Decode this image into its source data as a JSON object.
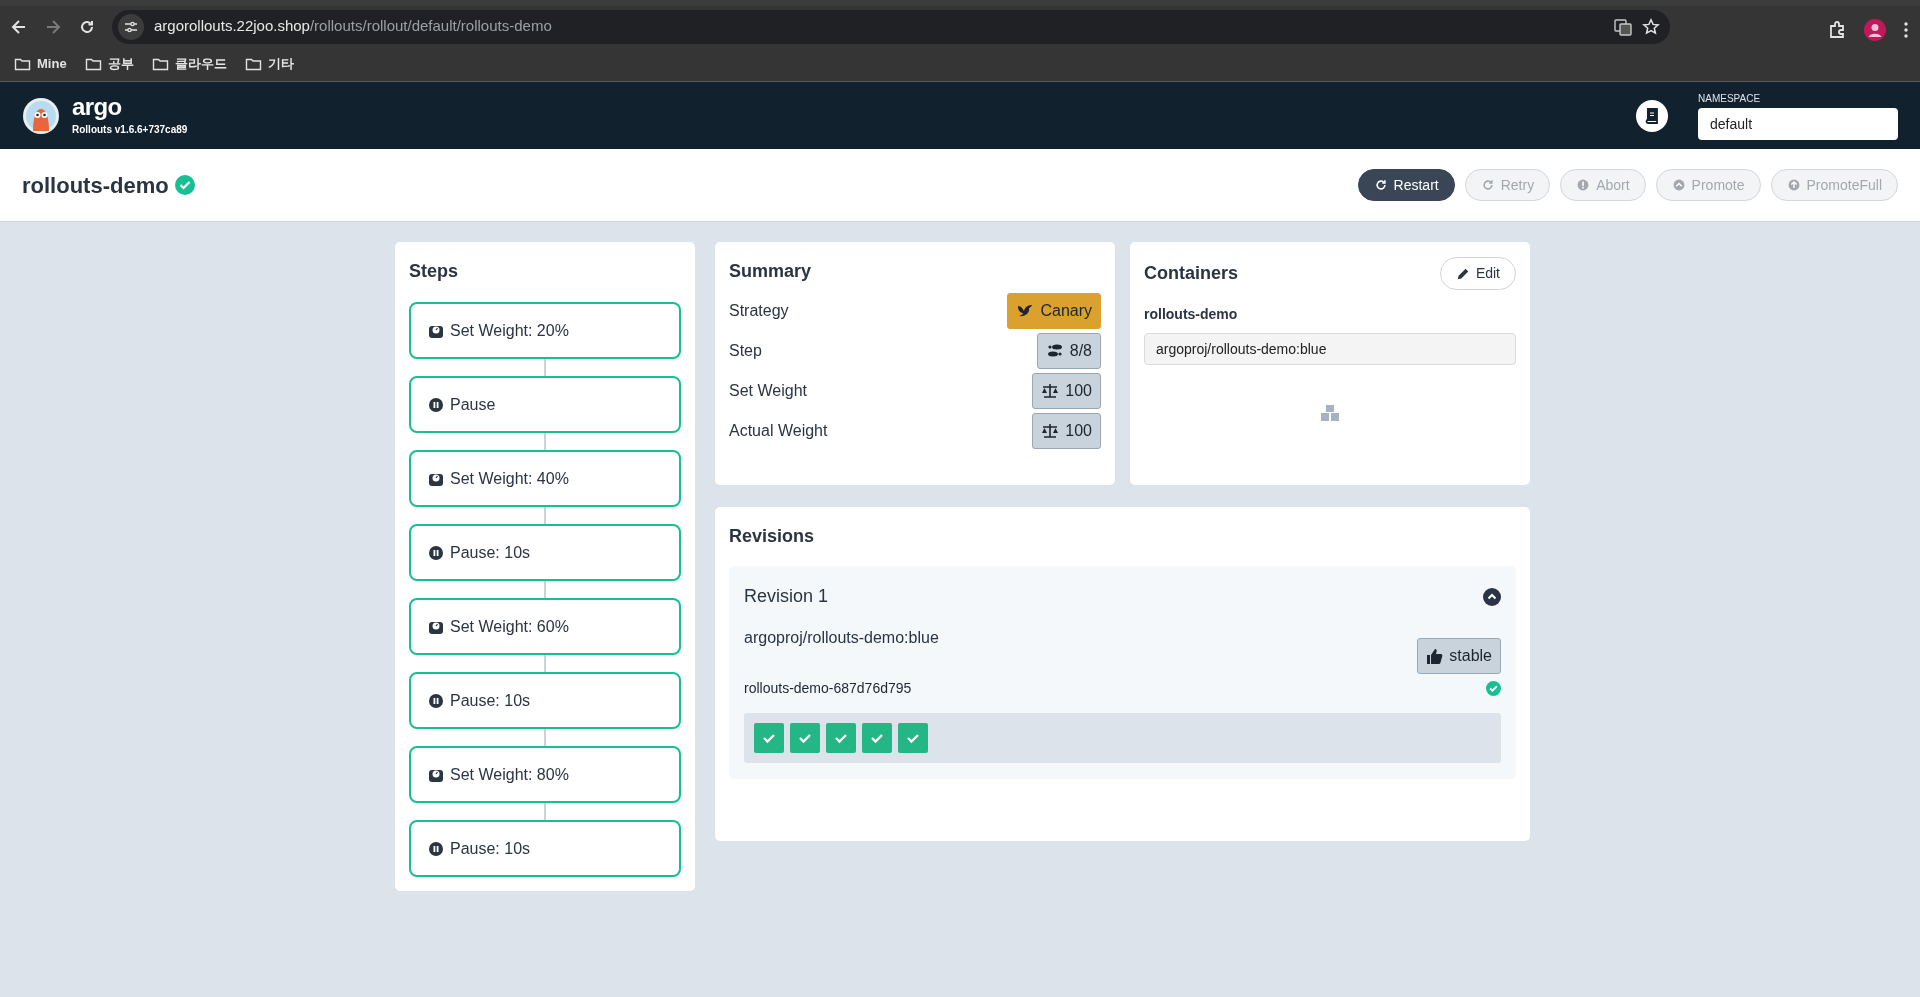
{
  "browser": {
    "url_host": "argorollouts.22joo.shop",
    "url_path": "/rollouts/rollout/default/rollouts-demo",
    "bookmarks": [
      "Mine",
      "공부",
      "클라우드",
      "기타"
    ]
  },
  "header": {
    "logo": "argo",
    "version": "Rollouts v1.6.6+737ca89",
    "namespace_label": "NAMESPACE",
    "namespace": "default"
  },
  "rollout": {
    "name": "rollouts-demo",
    "healthy": true,
    "actions": [
      {
        "label": "Restart",
        "kind": "restart",
        "disabled": false
      },
      {
        "label": "Retry",
        "kind": "retry",
        "disabled": true
      },
      {
        "label": "Abort",
        "kind": "abort",
        "disabled": true
      },
      {
        "label": "Promote",
        "kind": "promote",
        "disabled": true
      },
      {
        "label": "PromoteFull",
        "kind": "promotefull",
        "disabled": true
      }
    ]
  },
  "steps": {
    "title": "Steps",
    "items": [
      {
        "kind": "weight",
        "label": "Set Weight: 20%",
        "complete": true
      },
      {
        "kind": "pause",
        "label": "Pause",
        "complete": true
      },
      {
        "kind": "weight",
        "label": "Set Weight: 40%",
        "complete": true
      },
      {
        "kind": "pause",
        "label": "Pause: 10s",
        "complete": true
      },
      {
        "kind": "weight",
        "label": "Set Weight: 60%",
        "complete": true
      },
      {
        "kind": "pause",
        "label": "Pause: 10s",
        "complete": true
      },
      {
        "kind": "weight",
        "label": "Set Weight: 80%",
        "complete": true
      },
      {
        "kind": "pause",
        "label": "Pause: 10s",
        "complete": true
      }
    ]
  },
  "summary": {
    "title": "Summary",
    "rows": [
      {
        "label": "Strategy",
        "kind": "strategy",
        "value": "Canary"
      },
      {
        "label": "Step",
        "kind": "step",
        "value": "8/8"
      },
      {
        "label": "Set Weight",
        "kind": "weight",
        "value": "100"
      },
      {
        "label": "Actual Weight",
        "kind": "weight",
        "value": "100"
      }
    ]
  },
  "containers": {
    "title": "Containers",
    "edit": "Edit",
    "items": [
      {
        "name": "rollouts-demo",
        "image": "argoproj/rollouts-demo:blue"
      }
    ]
  },
  "revisions": {
    "title": "Revisions",
    "items": [
      {
        "title": "Revision 1",
        "expanded": true,
        "image": "argoproj/rollouts-demo:blue",
        "badge": "stable",
        "replicasets": [
          {
            "name": "rollouts-demo-687d76d795",
            "healthy": true,
            "pods": [
              {
                "ready": true
              },
              {
                "ready": true
              },
              {
                "ready": true
              },
              {
                "ready": true
              },
              {
                "ready": true
              }
            ]
          }
        ]
      }
    ]
  }
}
